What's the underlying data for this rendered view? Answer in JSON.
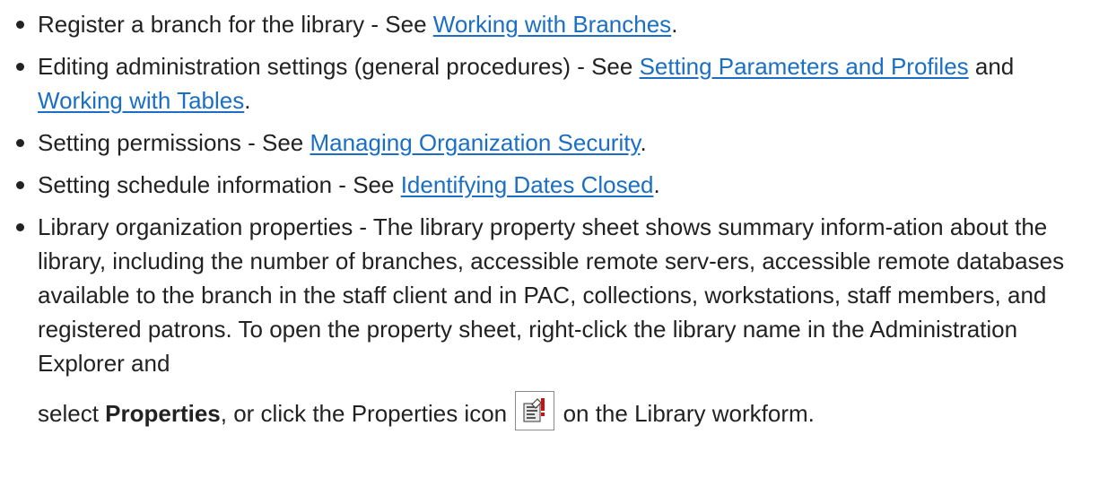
{
  "items": [
    {
      "pre": "Register a branch for the library - See ",
      "link1": "Working with Branches",
      "post": "."
    },
    {
      "pre": "Editing administration settings (general procedures) - See ",
      "link1": "Setting Parameters and Profiles",
      "mid": " and ",
      "link2": "Working with Tables",
      "post": "."
    },
    {
      "pre": "Setting permissions - See ",
      "link1": "Managing Organization Security",
      "post": "."
    },
    {
      "pre": "Setting schedule information - See ",
      "link1": "Identifying Dates Closed",
      "post": "."
    },
    {
      "text": "Library organization properties - The library property sheet shows summary inform-ation about the library, including the number of branches, accessible remote serv-ers, accessible remote databases available to the branch in the staff client and in PAC, collections, workstations, staff members, and registered patrons. To open the property sheet, right-click the library name in the Administration Explorer and",
      "select_pre": "select ",
      "bold": "Properties",
      "select_mid": ", or click the Properties icon ",
      "icon": "properties-icon",
      "select_post": " on the Library workform."
    }
  ]
}
